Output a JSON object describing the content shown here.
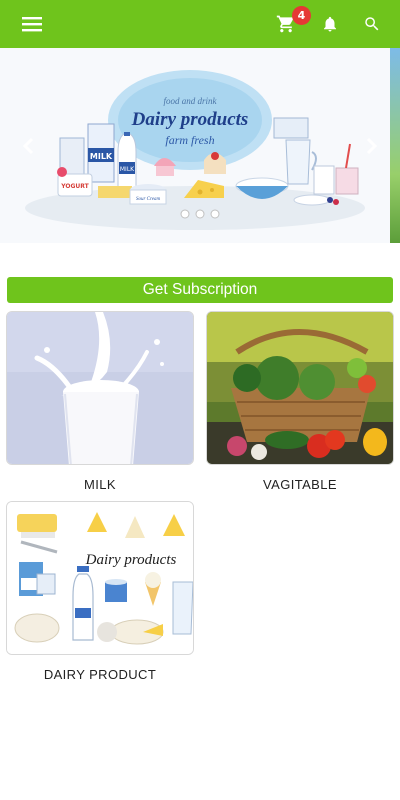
{
  "appbar": {
    "color": "#6fc41c",
    "cart_count": "4",
    "icons": [
      "menu-icon",
      "cart-icon",
      "bell-icon",
      "search-icon"
    ]
  },
  "banner": {
    "heading_small": "food and drink",
    "heading_main": "Dairy products",
    "heading_sub": "farm fresh",
    "carton_label": "MILK",
    "bottle_label": "MILK",
    "yogurt_label": "YOGURT",
    "sour_cream_label": "Sour Cream"
  },
  "subscription": {
    "label": "Get Subscription"
  },
  "products": [
    {
      "name": "MILK"
    },
    {
      "name": "VAGITABLE"
    },
    {
      "name": "DAIRY PRODUCT",
      "image_text": "Dairy products"
    }
  ]
}
